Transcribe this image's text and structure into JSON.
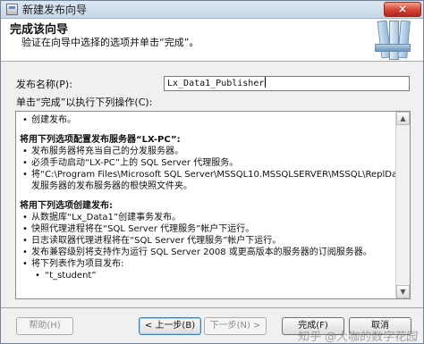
{
  "window": {
    "title": "新建发布向导",
    "close_label": "×"
  },
  "header": {
    "title": "完成该向导",
    "subtitle": "验证在向导中选择的选项并单击“完成”。",
    "icon": "books-icon"
  },
  "form": {
    "publisher_label": "发布名称(P):",
    "publisher_value": "Lx_Data1_Publisher",
    "actions_label": "单击“完成”以执行下列操作(C):"
  },
  "summary": {
    "lines": [
      "创建发布。",
      "",
      "将用下列选项配置发布服务器“LX-PC”:",
      "发布服务器将充当自己的分发服务器。",
      "必须手动启动“LX-PC”上的 SQL Server 代理服务。",
      "将“C:\\Program Files\\Microsoft SQL Server\\MSSQL10.MSSQLSERVER\\MSSQL\\ReplData”用作使用此分",
      "发服务器的发布服务器的根快照文件夹。",
      "",
      "将用下列选项创建发布:",
      "从数据库“Lx_Data1”创建事务发布。",
      "快照代理进程将在“SQL Server 代理服务”帐户下运行。",
      "日志读取器代理进程将在“SQL Server 代理服务”帐户下运行。",
      "发布兼容级别将支持作为运行 SQL Server 2008 或更高版本的服务器的订阅服务器。",
      "将下列表作为项目发布:",
      "“t_student”"
    ],
    "scroll_up": "▲",
    "scroll_down": "▼"
  },
  "buttons": {
    "help": "帮助(H)",
    "back": "< 上一步(B)",
    "next": "下一步(N) >",
    "finish": "完成(F)",
    "cancel": "取消"
  },
  "watermark": "知乎 @大咖的数字花园"
}
